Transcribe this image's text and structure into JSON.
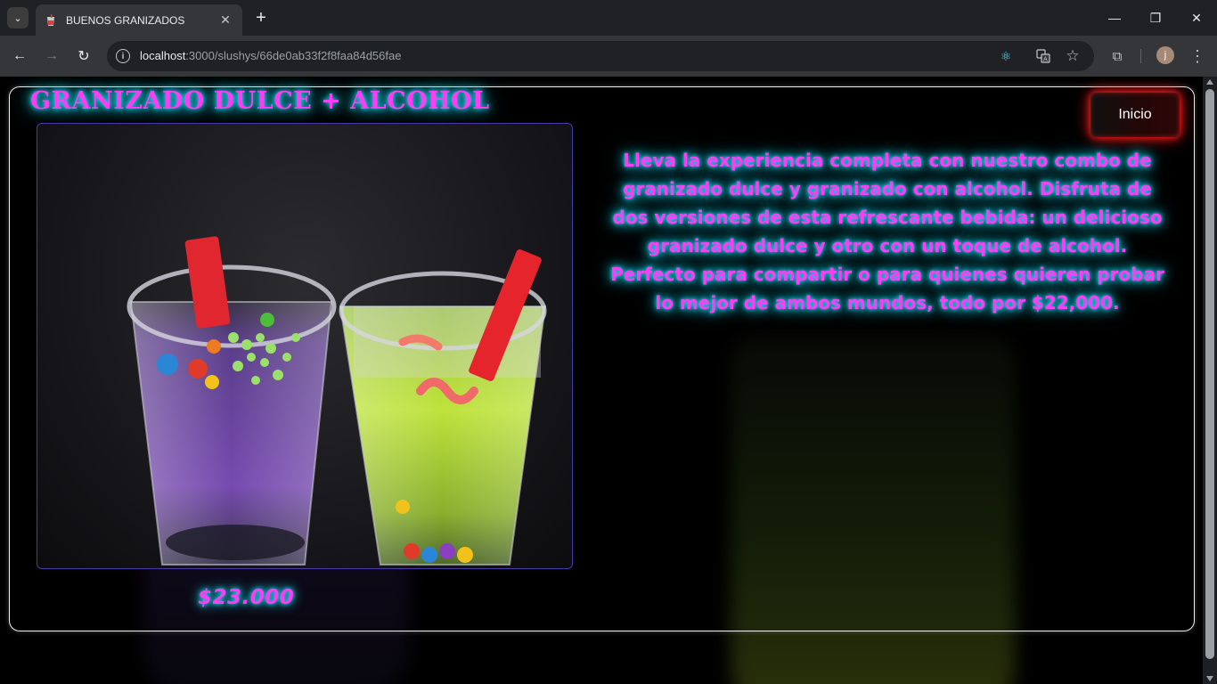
{
  "browser": {
    "tab_title": "BUENOS GRANIZADOS",
    "url_host": "localhost",
    "url_rest": ":3000/slushys/66de0ab33f2f8faa84d56fae",
    "profile_initial": "j"
  },
  "page": {
    "title": "GRANIZADO DULCE + ALCOHOL",
    "home_label": "Inicio",
    "price": "$23.000",
    "description": "Lleva la experiencia completa con nuestro combo de granizado dulce y granizado con alcohol. Disfruta de dos versiones de esta refrescante bebida: un delicioso granizado dulce y otro con un toque de alcohol. Perfecto para compartir o para quienes quieren probar lo mejor de ambos mundos, todo por $22,000."
  },
  "colors": {
    "neon_text": "#ff3cf5",
    "neon_glow": "#1ee6ff",
    "button_glow": "#ff1a1a"
  }
}
